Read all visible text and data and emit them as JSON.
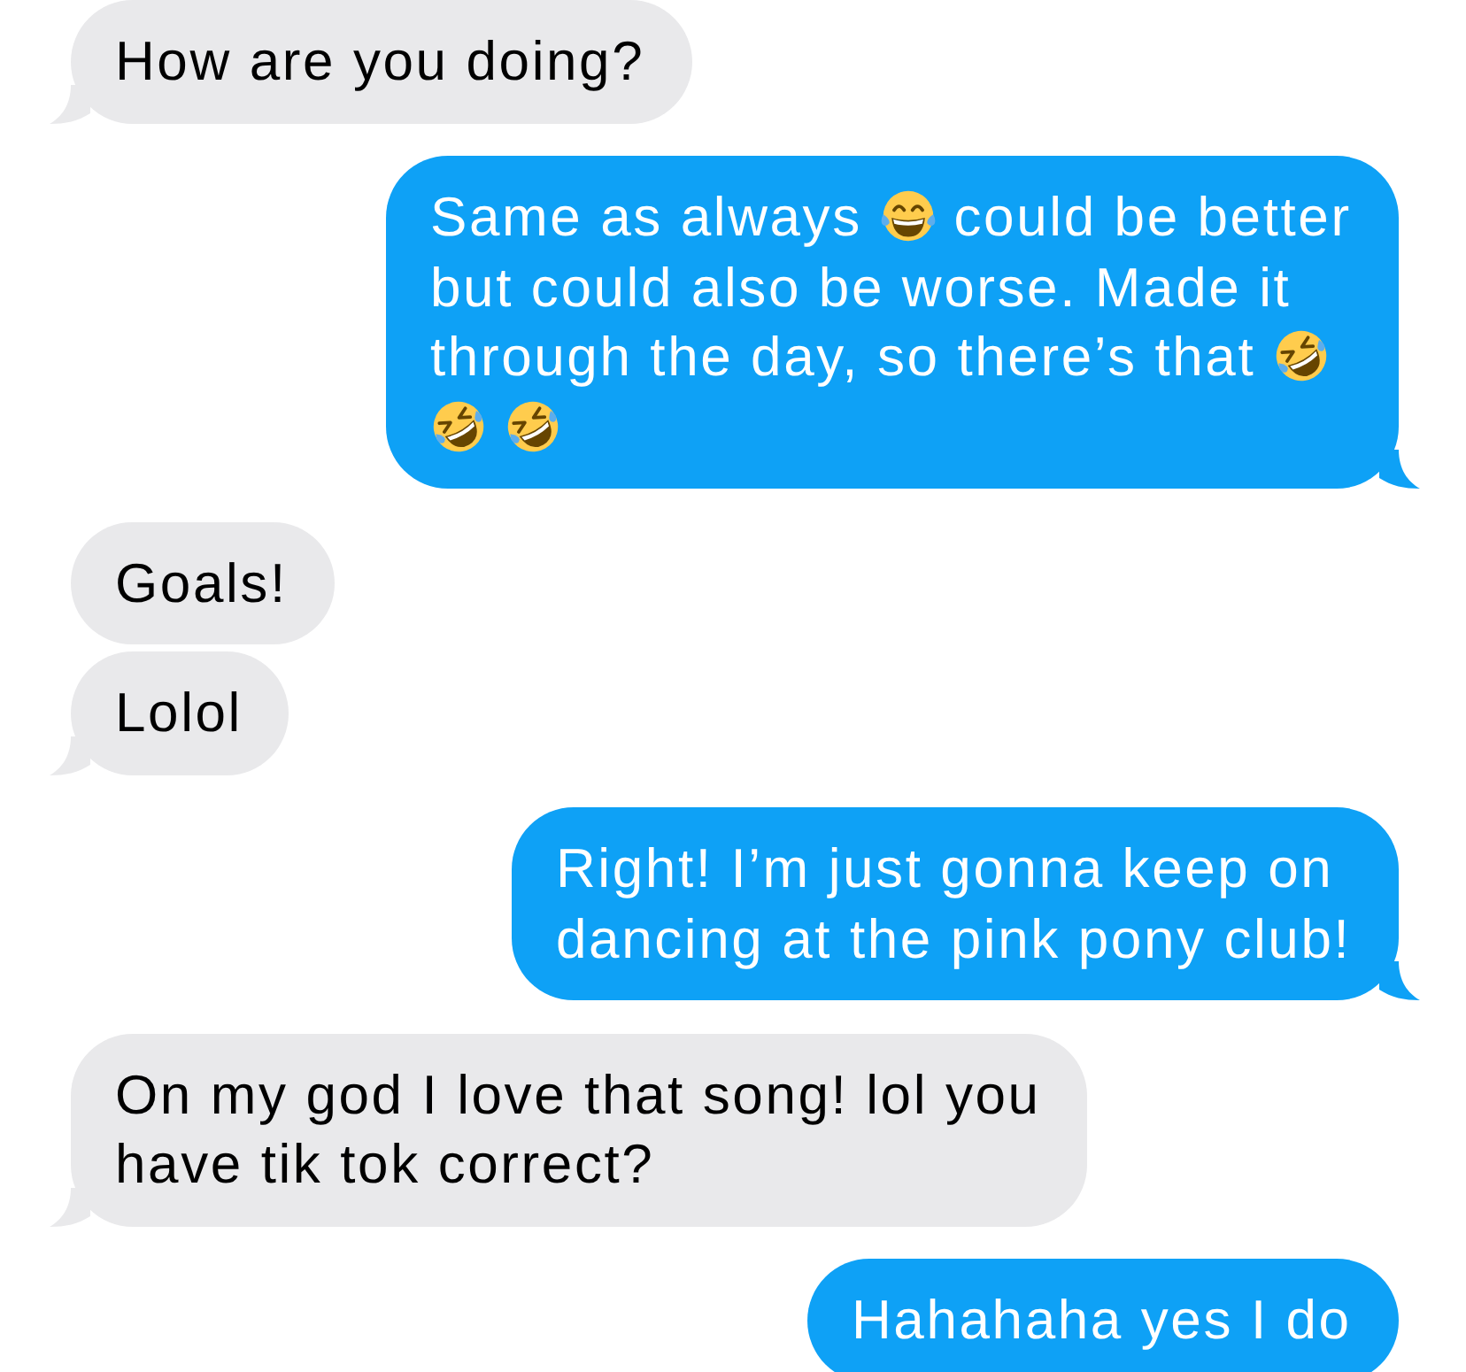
{
  "messages": [
    {
      "kind": "received",
      "tail": true,
      "parts": [
        {
          "kind": "text",
          "text": "How are you doing?"
        }
      ]
    },
    {
      "kind": "sent",
      "tail": true,
      "parts": [
        {
          "kind": "text",
          "text": "Same as always"
        },
        {
          "kind": "joy"
        },
        {
          "kind": "text",
          "text": "could be better"
        },
        {
          "kind": "text",
          "text": "but could also be worse. Made it"
        },
        {
          "kind": "text",
          "text": "through the day, so there’s that"
        },
        {
          "kind": "rofl"
        },
        {
          "kind": "rofl"
        },
        {
          "kind": "rofl"
        }
      ]
    },
    {
      "kind": "received",
      "tail": false,
      "parts": [
        {
          "kind": "text",
          "text": "Goals!"
        }
      ]
    },
    {
      "kind": "received",
      "tail": true,
      "parts": [
        {
          "kind": "text",
          "text": "Lolol"
        }
      ]
    },
    {
      "kind": "sent",
      "tail": true,
      "parts": [
        {
          "kind": "text",
          "text": "Right! I’m just gonna keep on dancing at the pink pony club!"
        }
      ]
    },
    {
      "kind": "received",
      "tail": true,
      "parts": [
        {
          "kind": "text",
          "text": "On my god I love that song! lol you have tik tok correct?"
        }
      ]
    },
    {
      "kind": "sent",
      "tail": false,
      "parts": [
        {
          "kind": "text",
          "text": "Hahahaha yes I do"
        }
      ]
    }
  ]
}
